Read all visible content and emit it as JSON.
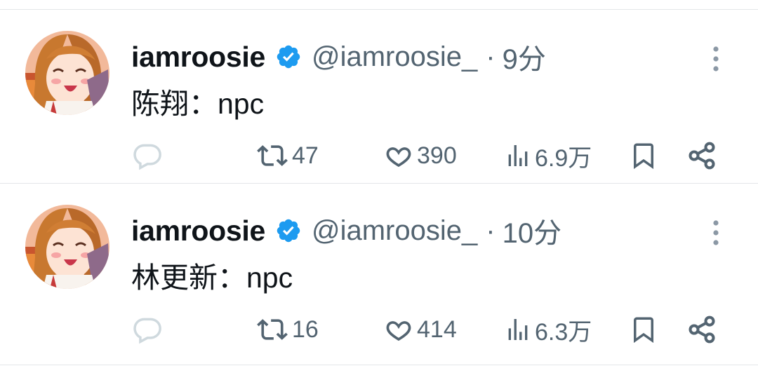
{
  "tweets": [
    {
      "name": "iamroosie",
      "handle": "@iamroosie_",
      "dot": "·",
      "time": "9分",
      "text": "陈翔：npc",
      "retweets": "47",
      "likes": "390",
      "views": "6.9万"
    },
    {
      "name": "iamroosie",
      "handle": "@iamroosie_",
      "dot": "·",
      "time": "10分",
      "text": "林更新：npc",
      "retweets": "16",
      "likes": "414",
      "views": "6.3万"
    }
  ],
  "icons": {
    "verified": "verified-badge-icon",
    "more": "more-vertical-icon",
    "reply": "reply-icon",
    "retweet": "retweet-icon",
    "like": "heart-icon",
    "views": "views-chart-icon",
    "bookmark": "bookmark-icon",
    "share": "share-icon"
  },
  "colors": {
    "verified": "#1d9bf0",
    "secondary_text": "#536471",
    "reply_icon": "#cfd9de",
    "divider": "#e3e6e9"
  }
}
